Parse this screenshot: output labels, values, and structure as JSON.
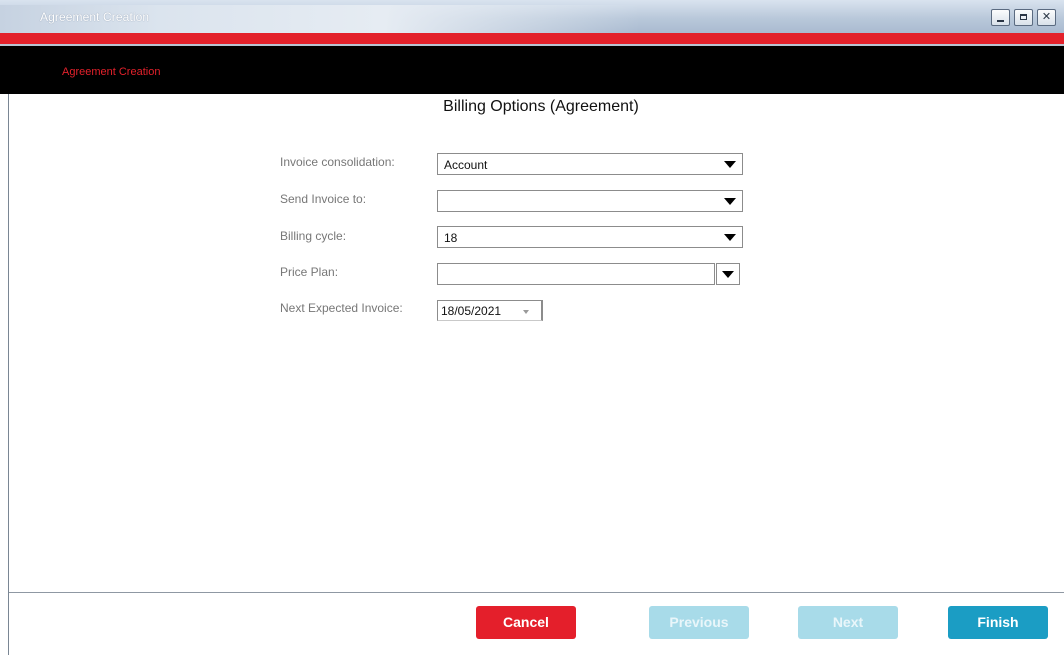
{
  "window": {
    "title": "Agreement Creation",
    "controls": {
      "minimize_icon": "minimize-icon",
      "maximize_icon": "maximize-icon",
      "close_glyph": "✕"
    }
  },
  "header": {
    "breadcrumb": "Agreement Creation"
  },
  "page": {
    "title": "Billing Options (Agreement)"
  },
  "form": {
    "invoice_consolidation": {
      "label": "Invoice consolidation:",
      "value": "Account"
    },
    "send_invoice_to": {
      "label": "Send Invoice to:",
      "value": ""
    },
    "billing_cycle": {
      "label": "Billing cycle:",
      "value": "18"
    },
    "price_plan": {
      "label": "Price Plan:",
      "value": ""
    },
    "next_expected_invoice": {
      "label": "Next Expected Invoice:",
      "value": "18/05/2021"
    }
  },
  "footer": {
    "cancel_label": "Cancel",
    "previous_label": "Previous",
    "next_label": "Next",
    "finish_label": "Finish"
  },
  "colors": {
    "accent_red": "#e3212b",
    "header_black": "#000000",
    "finish_blue": "#1b9dc4",
    "disabled_blue": "#a8dbe9"
  }
}
